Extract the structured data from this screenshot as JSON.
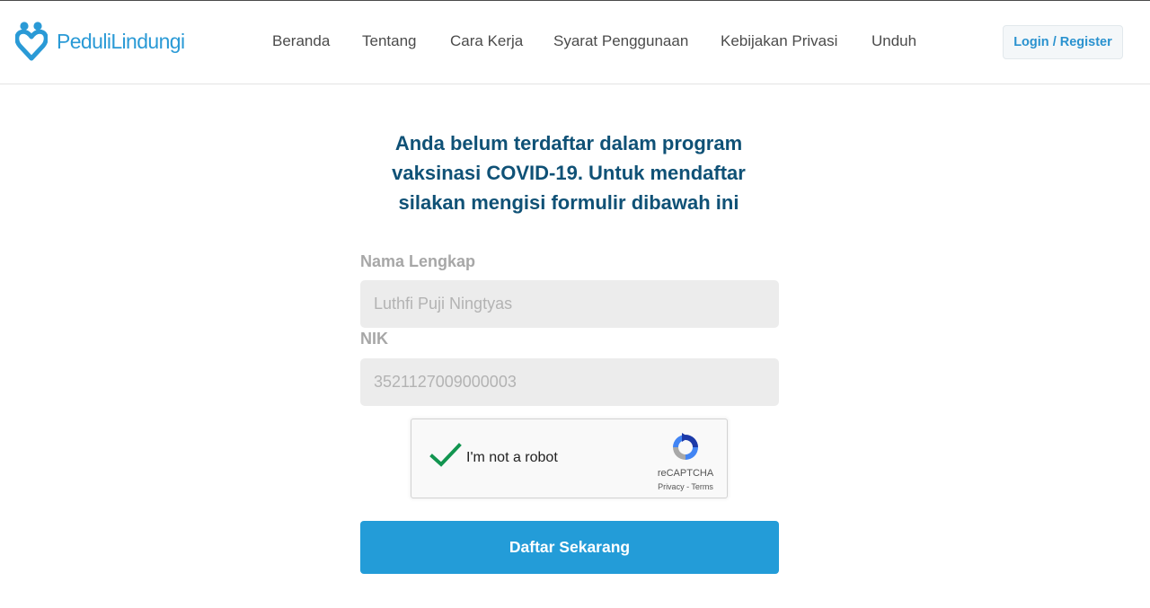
{
  "brand": {
    "name": "PeduliLindungi",
    "color": "#2a9ad6"
  },
  "nav": {
    "items": [
      "Beranda",
      "Tentang",
      "Cara Kerja",
      "Syarat Penggunaan",
      "Kebijakan Privasi",
      "Unduh"
    ]
  },
  "header": {
    "login_label": "Login / Register"
  },
  "main": {
    "heading_lines": [
      "Anda belum terdaftar dalam program",
      "vaksinasi COVID-19. Untuk mendaftar",
      "silakan mengisi formulir dibawah ini"
    ],
    "name_label": "Nama Lengkap",
    "name_value": "Luthfi Puji Ningtyas",
    "nik_label": "NIK",
    "nik_value": "3521127009000003",
    "submit_label": "Daftar Sekarang"
  },
  "captcha": {
    "label": "I'm not a robot",
    "brand": "reCAPTCHA",
    "privacy": "Privacy",
    "separator": " - ",
    "terms": "Terms",
    "checked": true
  },
  "colors": {
    "heading": "#0f5176",
    "primary": "#239cd8",
    "check": "#129550"
  }
}
